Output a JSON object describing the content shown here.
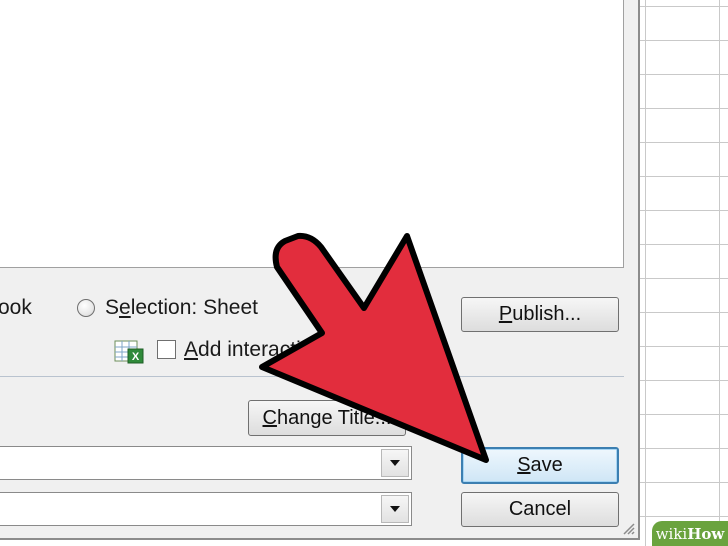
{
  "dialog": {
    "publish_scope": {
      "workbook_partial": "ook",
      "selection_prefix": "S",
      "selection_accel": "e",
      "selection_suffix": "lection: Sheet"
    },
    "add_interactivity": {
      "accel": "A",
      "rest": "dd interactivity"
    },
    "buttons": {
      "publish_accel": "P",
      "publish_rest": "ublish...",
      "change_title_accel": "C",
      "change_title_rest": "hange Title...",
      "save_accel": "S",
      "save_rest": "ave",
      "cancel": "Cancel"
    },
    "combos": {
      "file_name_value": "",
      "save_as_type_value": ""
    }
  },
  "watermark": {
    "wiki": "wiki",
    "how": "How"
  },
  "colors": {
    "arrow_fill": "#e22d3d",
    "arrow_stroke": "#000000",
    "default_button_border": "#3c7fb1",
    "wikihow_green": "#6aa33e"
  },
  "icons": [
    "radio-button-icon",
    "excel-sheet-icon",
    "dropdown-arrow-icon",
    "resize-grip-icon",
    "annotation-arrow-icon"
  ]
}
